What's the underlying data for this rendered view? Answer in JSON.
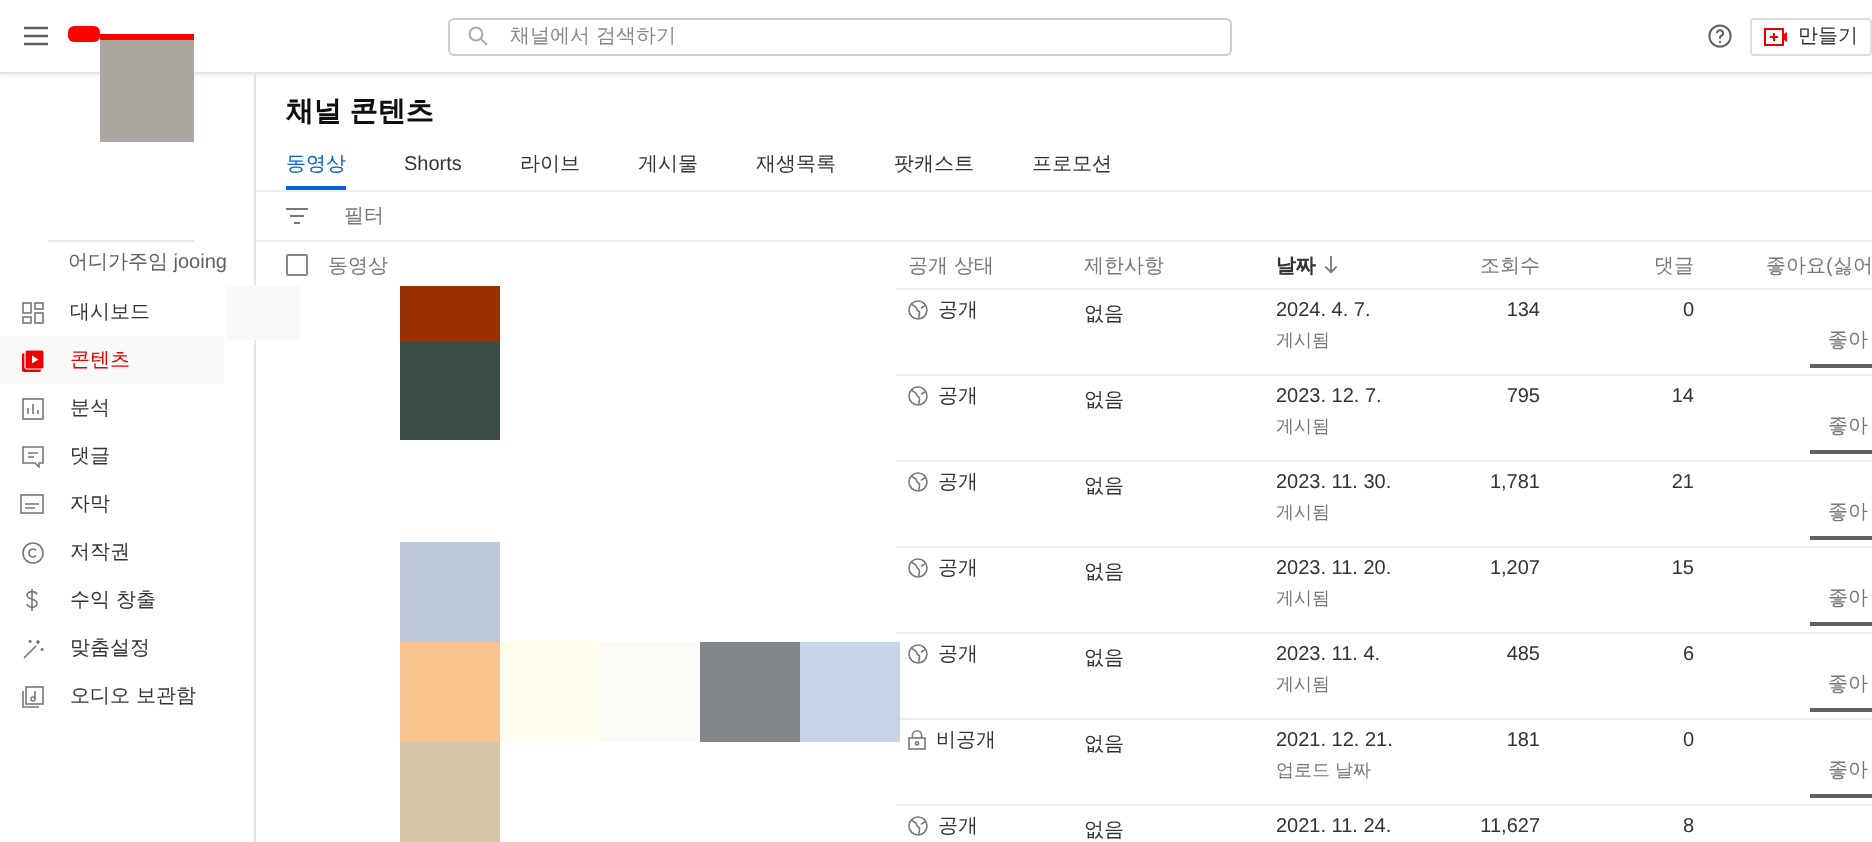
{
  "topbar": {
    "search": {
      "placeholder": "채널에서 검색하기"
    },
    "create_button": "만들기"
  },
  "sidebar": {
    "channel_name": "어디가주임 jooing",
    "items": [
      {
        "label": "대시보드",
        "kind": "dashboard",
        "selected": false
      },
      {
        "label": "콘텐츠",
        "kind": "content",
        "selected": true
      },
      {
        "label": "분석",
        "kind": "analytics",
        "selected": false
      },
      {
        "label": "댓글",
        "kind": "comments",
        "selected": false
      },
      {
        "label": "자막",
        "kind": "subtitles",
        "selected": false
      },
      {
        "label": "저작권",
        "kind": "copyright",
        "selected": false
      },
      {
        "label": "수익 창출",
        "kind": "earn",
        "selected": false
      },
      {
        "label": "맞춤설정",
        "kind": "customize",
        "selected": false
      },
      {
        "label": "오디오 보관함",
        "kind": "audio",
        "selected": false
      }
    ]
  },
  "page_title": "채널 콘텐츠",
  "tabs": [
    {
      "label": "동영상",
      "selected": true
    },
    {
      "label": "Shorts",
      "selected": false
    },
    {
      "label": "라이브",
      "selected": false
    },
    {
      "label": "게시물",
      "selected": false
    },
    {
      "label": "재생목록",
      "selected": false
    },
    {
      "label": "팟캐스트",
      "selected": false
    },
    {
      "label": "프로모션",
      "selected": false
    }
  ],
  "filter": {
    "placeholder": "필터"
  },
  "table": {
    "select_all_checked": false,
    "columns": [
      "동영상",
      "공개 상태",
      "제한사항",
      "날짜",
      "조회수",
      "댓글",
      "좋아요(싫어"
    ],
    "rows": [
      {
        "visibility": "공개",
        "kind": "public",
        "restrictions": "없음",
        "date": "2024. 4. 7.",
        "date_note": "게시됨",
        "views": "134",
        "comments": "0",
        "likes_label": "좋아",
        "level": 1
      },
      {
        "visibility": "공개",
        "kind": "public",
        "restrictions": "없음",
        "date": "2023. 12. 7.",
        "date_note": "게시됨",
        "views": "795",
        "comments": "14",
        "likes_label": "좋아",
        "level": 1
      },
      {
        "visibility": "공개",
        "kind": "public",
        "restrictions": "없음",
        "date": "2023. 11. 30.",
        "date_note": "게시됨",
        "views": "1,781",
        "comments": "21",
        "likes_label": "좋아",
        "level": 1
      },
      {
        "visibility": "공개",
        "kind": "public",
        "restrictions": "없음",
        "date": "2023. 11. 20.",
        "date_note": "게시됨",
        "views": "1,207",
        "comments": "15",
        "likes_label": "좋아",
        "level": 1
      },
      {
        "visibility": "공개",
        "kind": "public",
        "restrictions": "없음",
        "date": "2023. 11. 4.",
        "date_note": "게시됨",
        "views": "485",
        "comments": "6",
        "likes_label": "좋아",
        "level": 1
      },
      {
        "visibility": "비공개",
        "kind": "private",
        "restrictions": "없음",
        "date": "2021. 12. 21.",
        "date_note": "업로드 날짜",
        "views": "181",
        "comments": "0",
        "likes_label": "좋아",
        "level": 1
      },
      {
        "visibility": "공개",
        "kind": "public",
        "restrictions": "없음",
        "date": "2021. 11. 24.",
        "views": "11,627",
        "comments": "8"
      }
    ]
  }
}
